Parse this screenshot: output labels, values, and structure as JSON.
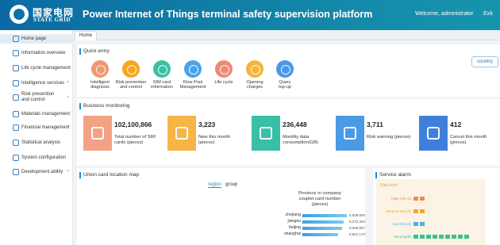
{
  "header": {
    "logo_cn": "国家电网",
    "logo_en": "STATE GRID",
    "title": "Power Internet of Things terminal safety supervision platform",
    "welcome": "Welcome, administrator",
    "exit": "Exit"
  },
  "sidebar": {
    "items": [
      {
        "label": "Home page",
        "icon": "home-icon",
        "caret": ""
      },
      {
        "label": "Information overview",
        "icon": "info-icon",
        "caret": ""
      },
      {
        "label": "Life cycle management",
        "icon": "cycle-icon",
        "caret": ""
      },
      {
        "label": "Intelligence services",
        "icon": "brain-icon",
        "caret": "⌄"
      },
      {
        "label": "Risk prevention and control",
        "icon": "shield-icon",
        "caret": "⌄"
      },
      {
        "label": "Materials management",
        "icon": "box-icon",
        "caret": ""
      },
      {
        "label": "Financial management",
        "icon": "finance-icon",
        "caret": ""
      },
      {
        "label": "Statistical analysis",
        "icon": "chart-icon",
        "caret": ""
      },
      {
        "label": "System configuration",
        "icon": "gear-icon",
        "caret": ""
      },
      {
        "label": "Development ability",
        "icon": "dev-icon",
        "caret": "⌄"
      }
    ]
  },
  "tabs": {
    "home": "Home"
  },
  "quick_entry": {
    "title": "Quick entry",
    "country_button": "country",
    "items": [
      {
        "label": "Intelligent\ndiagnosis",
        "color": "#f19872",
        "icon": "diagnosis-icon"
      },
      {
        "label": "Risk prevention\nand control",
        "color": "#f5a623",
        "icon": "risk-icon"
      },
      {
        "label": "SIM card\ninformation",
        "color": "#3cc0a6",
        "icon": "sim-icon"
      },
      {
        "label": "Flow Pool\nManagement",
        "color": "#4aa3e8",
        "icon": "flow-icon"
      },
      {
        "label": "Life cycle",
        "color": "#f08a78",
        "icon": "lifecycle-icon"
      },
      {
        "label": "Opening\ncharges",
        "color": "#f4b43b",
        "icon": "charges-icon"
      },
      {
        "label": "Query\ntop-up",
        "color": "#4b97e6",
        "icon": "query-icon"
      }
    ]
  },
  "business": {
    "title": "Business monitoring",
    "cards": [
      {
        "value": "102,100,866",
        "label": "Total number of SIM cards  (pieces)",
        "color": "#f3a283",
        "icon": "simcard-icon"
      },
      {
        "value": "3,223",
        "label": "New this month (pieces)",
        "color": "#f6b545",
        "icon": "newdoc-icon"
      },
      {
        "value": "236,448",
        "label": "Monthly data consumption(GB)",
        "color": "#39bfa6",
        "icon": "barchart-icon"
      },
      {
        "value": "3,711",
        "label": "Risk warning (pieces)",
        "color": "#4a9ae6",
        "icon": "lightning-icon"
      },
      {
        "value": "412",
        "label": "Cancel this month (pieces)",
        "color": "#3f7fdc",
        "icon": "pie-icon"
      }
    ]
  },
  "map": {
    "title": "Union card location map",
    "tab_region": "region",
    "tab_group": "group",
    "rank_title": "Province in company couplet card number (pieces)",
    "ranking": [
      {
        "name": "zhejiang",
        "value": 6839800,
        "label": "6,839,800"
      },
      {
        "name": "jiangsu",
        "value": 6372363,
        "label": "6,372,363"
      },
      {
        "name": "beijing",
        "value": 6096907,
        "label": "6,096,907"
      },
      {
        "name": "shanghai",
        "value": 5557174,
        "label": "5,557,174"
      }
    ]
  },
  "alarm": {
    "title": "Service alarm",
    "risk_level_label": "Risk level",
    "rows": [
      {
        "label": "High risk (4)",
        "count": 2,
        "color": "#f08a50"
      },
      {
        "label": "Medium risk (3)",
        "count": 2,
        "color": "#f5a623"
      },
      {
        "label": "Low risk (4)",
        "count": 2,
        "color": "#4ab0e8"
      },
      {
        "label": "security(9)",
        "count": 9,
        "color": "#3cc08c"
      }
    ]
  }
}
